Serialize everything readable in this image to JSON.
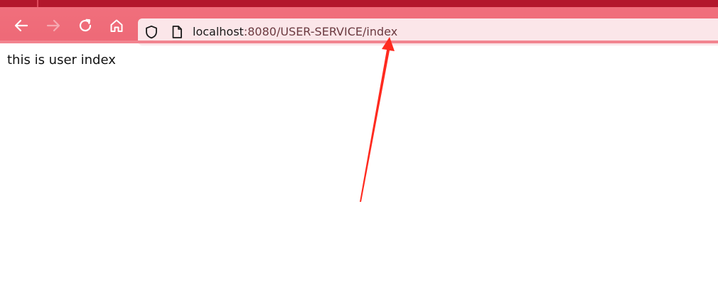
{
  "browser": {
    "toolbar": {
      "buttons": [
        {
          "name": "back",
          "icon": "back-arrow-icon"
        },
        {
          "name": "forward",
          "icon": "forward-arrow-icon",
          "disabled": true
        },
        {
          "name": "reload",
          "icon": "reload-icon"
        },
        {
          "name": "home",
          "icon": "home-icon"
        }
      ]
    },
    "url_bar": {
      "host": "localhost",
      "path": ":8080/USER-SERVICE/index",
      "icons": [
        "shield-icon",
        "page-icon"
      ]
    },
    "theme": {
      "accent": "#b3172c",
      "toolbar": "#ee6977",
      "urlbar_bg": "#fbe6e9"
    }
  },
  "page": {
    "text": "this is user index"
  },
  "annotation": {
    "type": "arrow",
    "color": "#ff2a1f"
  }
}
